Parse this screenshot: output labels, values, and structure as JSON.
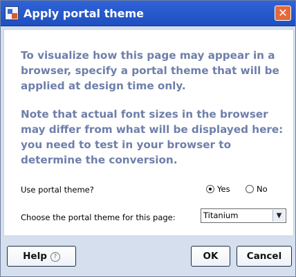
{
  "window": {
    "title": "Apply portal theme",
    "close_glyph": "✕"
  },
  "content": {
    "paragraph1": "To visualize how this page may appear in a browser, specify a portal theme that will be applied at design time only.",
    "paragraph2": "Note that actual font sizes in the browser may differ from what will be displayed here: you need to test in your browser to determine the conversion."
  },
  "form": {
    "use_theme_label": "Use portal theme?",
    "yes_label": "Yes",
    "no_label": "No",
    "selected_option": "Yes",
    "choose_theme_label": "Choose the portal theme for this page:",
    "theme_value": "Titanium"
  },
  "buttons": {
    "help_label": "Help",
    "help_icon_glyph": "?",
    "ok_label": "OK",
    "cancel_label": "Cancel"
  },
  "colors": {
    "titlebar": "#2f63d8",
    "close_button": "#e56a3a",
    "dialog_background": "#d5dfee",
    "instruction_text": "#6e7faa"
  }
}
